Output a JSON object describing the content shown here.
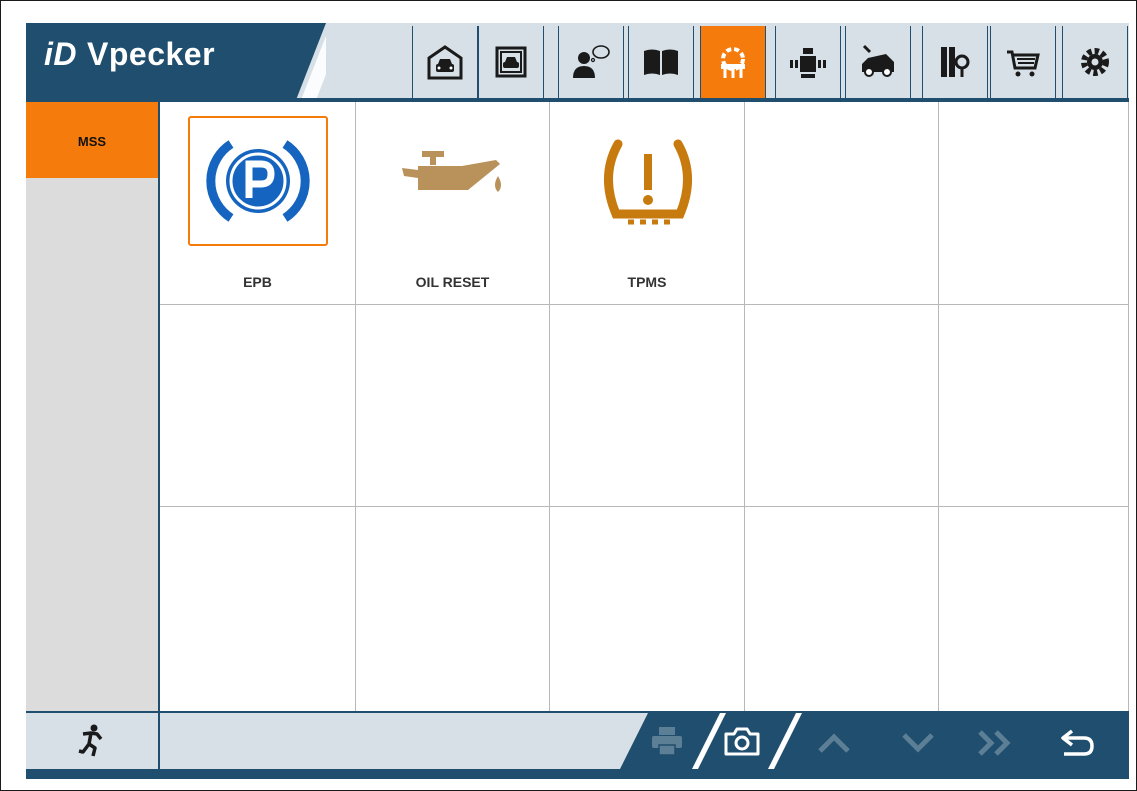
{
  "app": {
    "logo_mark": "iD",
    "logo_text": "Vpecker"
  },
  "colors": {
    "accent": "#f57c0c",
    "header_bg": "#d6e0e6",
    "dark_blue": "#1f4e6e",
    "epb_blue": "#1565c0",
    "oil_tan": "#b8925a",
    "tpms_amber": "#c77a0e"
  },
  "header": {
    "nav": [
      {
        "icon": "garage-car-icon",
        "active": false
      },
      {
        "icon": "vehicle-select-icon",
        "active": false
      },
      {
        "icon": "user-feedback-icon",
        "active": false
      },
      {
        "icon": "manual-book-icon",
        "active": false
      },
      {
        "icon": "special-function-icon",
        "active": true
      },
      {
        "icon": "engine-tool-icon",
        "active": false
      },
      {
        "icon": "car-repair-icon",
        "active": false
      },
      {
        "icon": "library-search-icon",
        "active": false
      },
      {
        "icon": "shopping-cart-icon",
        "active": false
      },
      {
        "icon": "settings-gear-icon",
        "active": false
      }
    ]
  },
  "sidebar": {
    "items": [
      {
        "label": "MSS",
        "active": true
      }
    ]
  },
  "grid": {
    "cells": [
      {
        "label": "EPB",
        "icon": "parking-brake-icon",
        "selected": true
      },
      {
        "label": "OIL RESET",
        "icon": "oil-can-icon",
        "selected": false
      },
      {
        "label": "TPMS",
        "icon": "tire-pressure-icon",
        "selected": false
      }
    ]
  },
  "footer": {
    "buttons": [
      {
        "icon": "exit-running-icon",
        "enabled": true
      },
      {
        "icon": "print-icon",
        "enabled": false
      },
      {
        "icon": "camera-icon",
        "enabled": true
      },
      {
        "icon": "chevron-up-icon",
        "enabled": false
      },
      {
        "icon": "chevron-down-icon",
        "enabled": false
      },
      {
        "icon": "double-chevron-right-icon",
        "enabled": false
      },
      {
        "icon": "back-return-icon",
        "enabled": true
      }
    ]
  }
}
